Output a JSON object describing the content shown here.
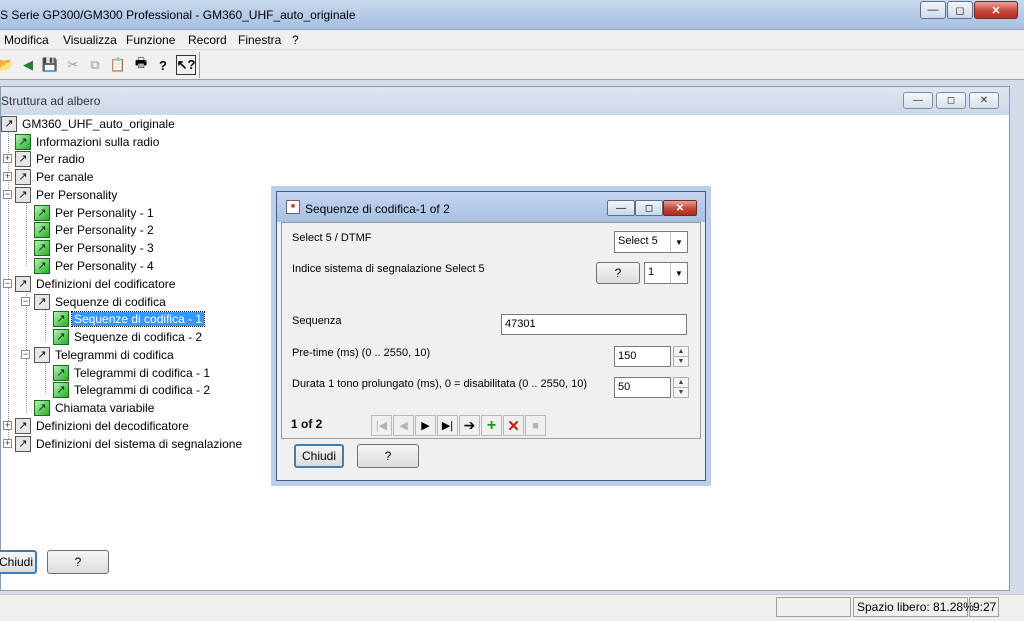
{
  "window": {
    "title": "S Serie GP300/GM300 Professional - GM360_UHF_auto_originale",
    "min_icon": "minimize-icon",
    "max_icon": "maximize-icon",
    "close_icon": "close-icon"
  },
  "menu": [
    "Modifica",
    "Visualizza",
    "Funzione",
    "Record",
    "Finestra",
    "?"
  ],
  "toolbar": {
    "icons": [
      "open-icon",
      "back-icon",
      "save-icon",
      "cut-icon",
      "copy-icon",
      "paste-icon",
      "print-icon",
      "help-icon",
      "context-help-icon"
    ]
  },
  "tree_window": {
    "title": "Struttura ad albero",
    "nodes": [
      {
        "label": "GM360_UHF_auto_originale"
      },
      {
        "label": "Informazioni sulla radio"
      },
      {
        "label": "Per radio"
      },
      {
        "label": "Per canale"
      },
      {
        "label": "Per Personality"
      },
      {
        "label": "Per Personality - 1"
      },
      {
        "label": "Per Personality - 2"
      },
      {
        "label": "Per Personality - 3"
      },
      {
        "label": "Per Personality - 4"
      },
      {
        "label": "Definizioni del codificatore"
      },
      {
        "label": "Sequenze di codifica"
      },
      {
        "label": "Sequenze di codifica - 1"
      },
      {
        "label": "Sequenze di codifica - 2"
      },
      {
        "label": "Telegrammi di codifica"
      },
      {
        "label": "Telegrammi di codifica - 1"
      },
      {
        "label": "Telegrammi di codifica - 2"
      },
      {
        "label": "Chiamata variabile"
      },
      {
        "label": "Definizioni del decodificatore"
      },
      {
        "label": "Definizioni del sistema di segnalazione"
      }
    ],
    "close_label": "Chiudi",
    "help_label": "?"
  },
  "dialog": {
    "title": "Sequenze di codifica-1 of 2",
    "select5_label": "Select 5 / DTMF",
    "select5_value": "Select 5",
    "index_label": "Indice sistema di segnalazione Select 5",
    "index_help": "?",
    "index_value": "1",
    "sequence_label": "Sequenza",
    "sequence_value": "47301",
    "pretime_label": "Pre-time (ms) (0 .. 2550, 10)",
    "pretime_value": "150",
    "duration_label": "Durata 1 tono prolungato (ms), 0 = disabilitata (0 .. 2550, 10)",
    "duration_value": "50",
    "record_count": "1 of 2",
    "close_label": "Chiudi",
    "help_label": "?"
  },
  "status": {
    "free_space": "Spazio libero: 81.28%",
    "time": "9:27"
  },
  "colors": {
    "selection": "#3399ff",
    "leaf_icon": "#23b023",
    "delete_icon": "#e01010"
  }
}
